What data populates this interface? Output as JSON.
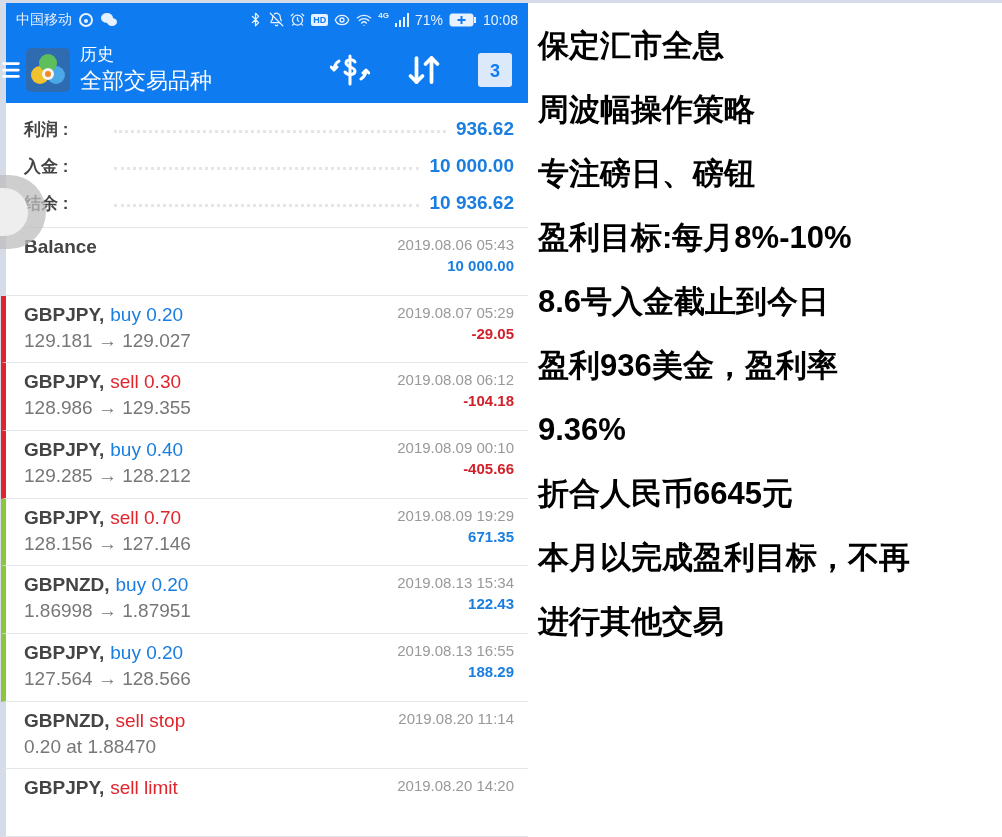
{
  "status_bar": {
    "carrier": "中国移动",
    "network": "4G",
    "battery": "71%",
    "time": "10:08",
    "hd": "HD"
  },
  "header": {
    "title": "历史",
    "subtitle": "全部交易品种",
    "calendar_day": "3"
  },
  "summary": [
    {
      "label": "利润 :",
      "value": "936.62"
    },
    {
      "label": "入金 :",
      "value": "10 000.00"
    },
    {
      "label": "结余 :",
      "value": "10 936.62"
    }
  ],
  "balance": {
    "label": "Balance",
    "time": "2019.08.06 05:43",
    "amount": "10 000.00"
  },
  "trades": [
    {
      "symbol": "GBPJPY,",
      "sell": false,
      "action": "buy 0.20",
      "prices": "129.181 → 129.027",
      "time": "2019.08.07 05:29",
      "profit": "-29.05",
      "loss": true,
      "color": "#e0242c"
    },
    {
      "symbol": "GBPJPY,",
      "sell": true,
      "action": "sell 0.30",
      "prices": "128.986 → 129.355",
      "time": "2019.08.08 06:12",
      "profit": "-104.18",
      "loss": true,
      "color": "#e0242c"
    },
    {
      "symbol": "GBPJPY,",
      "sell": false,
      "action": "buy 0.40",
      "prices": "129.285 → 128.212",
      "time": "2019.08.09 00:10",
      "profit": "-405.66",
      "loss": true,
      "color": "#e0242c"
    },
    {
      "symbol": "GBPJPY,",
      "sell": true,
      "action": "sell 0.70",
      "prices": "128.156 → 127.146",
      "time": "2019.08.09 19:29",
      "profit": "671.35",
      "loss": false,
      "color": "#8cc63f"
    },
    {
      "symbol": "GBPNZD,",
      "sell": false,
      "action": "buy 0.20",
      "prices": "1.86998 → 1.87951",
      "time": "2019.08.13 15:34",
      "profit": "122.43",
      "loss": false,
      "color": "#8cc63f"
    },
    {
      "symbol": "GBPJPY,",
      "sell": false,
      "action": "buy 0.20",
      "prices": "127.564 → 128.566",
      "time": "2019.08.13 16:55",
      "profit": "188.29",
      "loss": false,
      "color": "#8cc63f"
    },
    {
      "symbol": "GBPNZD,",
      "sell": true,
      "action": "sell stop",
      "prices": "0.20 at 1.88470",
      "time": "2019.08.20 11:14"
    },
    {
      "symbol": "GBPJPY,",
      "sell": true,
      "action": "sell limit",
      "time": "2019.08.20 14:20"
    }
  ],
  "notes": [
    "保定汇市全息",
    "周波幅操作策略",
    "专注磅日、磅钮",
    "盈利目标:每月8%-10%",
    "8.6号入金截止到今日",
    "盈利936美金，盈利率",
    "9.36%",
    "折合人民币6645元",
    "本月以完成盈利目标，不再",
    "进行其他交易"
  ]
}
